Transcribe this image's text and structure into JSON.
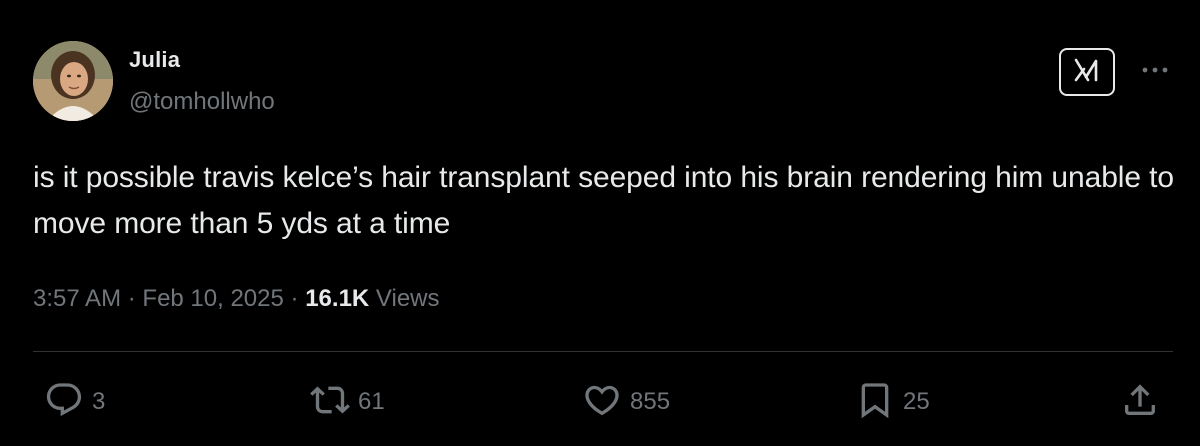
{
  "author": {
    "display_name": "Julia",
    "handle": "@tomhollwho"
  },
  "tweet": {
    "text": "is it possible travis kelce’s hair transplant seeped into his brain rendering him unable to move more than 5 yds at a time"
  },
  "meta": {
    "time": "3:57 AM",
    "separator": "·",
    "date": "Feb 10, 2025",
    "views_count": "16.1K",
    "views_label": "Views"
  },
  "actions": {
    "replies": "3",
    "reposts": "61",
    "likes": "855",
    "bookmarks": "25"
  },
  "icons": {
    "grok": "grok-icon",
    "more": "more-icon",
    "reply": "reply-icon",
    "repost": "repost-icon",
    "like": "heart-icon",
    "bookmark": "bookmark-icon",
    "share": "share-icon"
  },
  "colors": {
    "background": "#000000",
    "text_primary": "#e7e9ea",
    "text_secondary": "#71767b",
    "divider": "#2f3336"
  }
}
